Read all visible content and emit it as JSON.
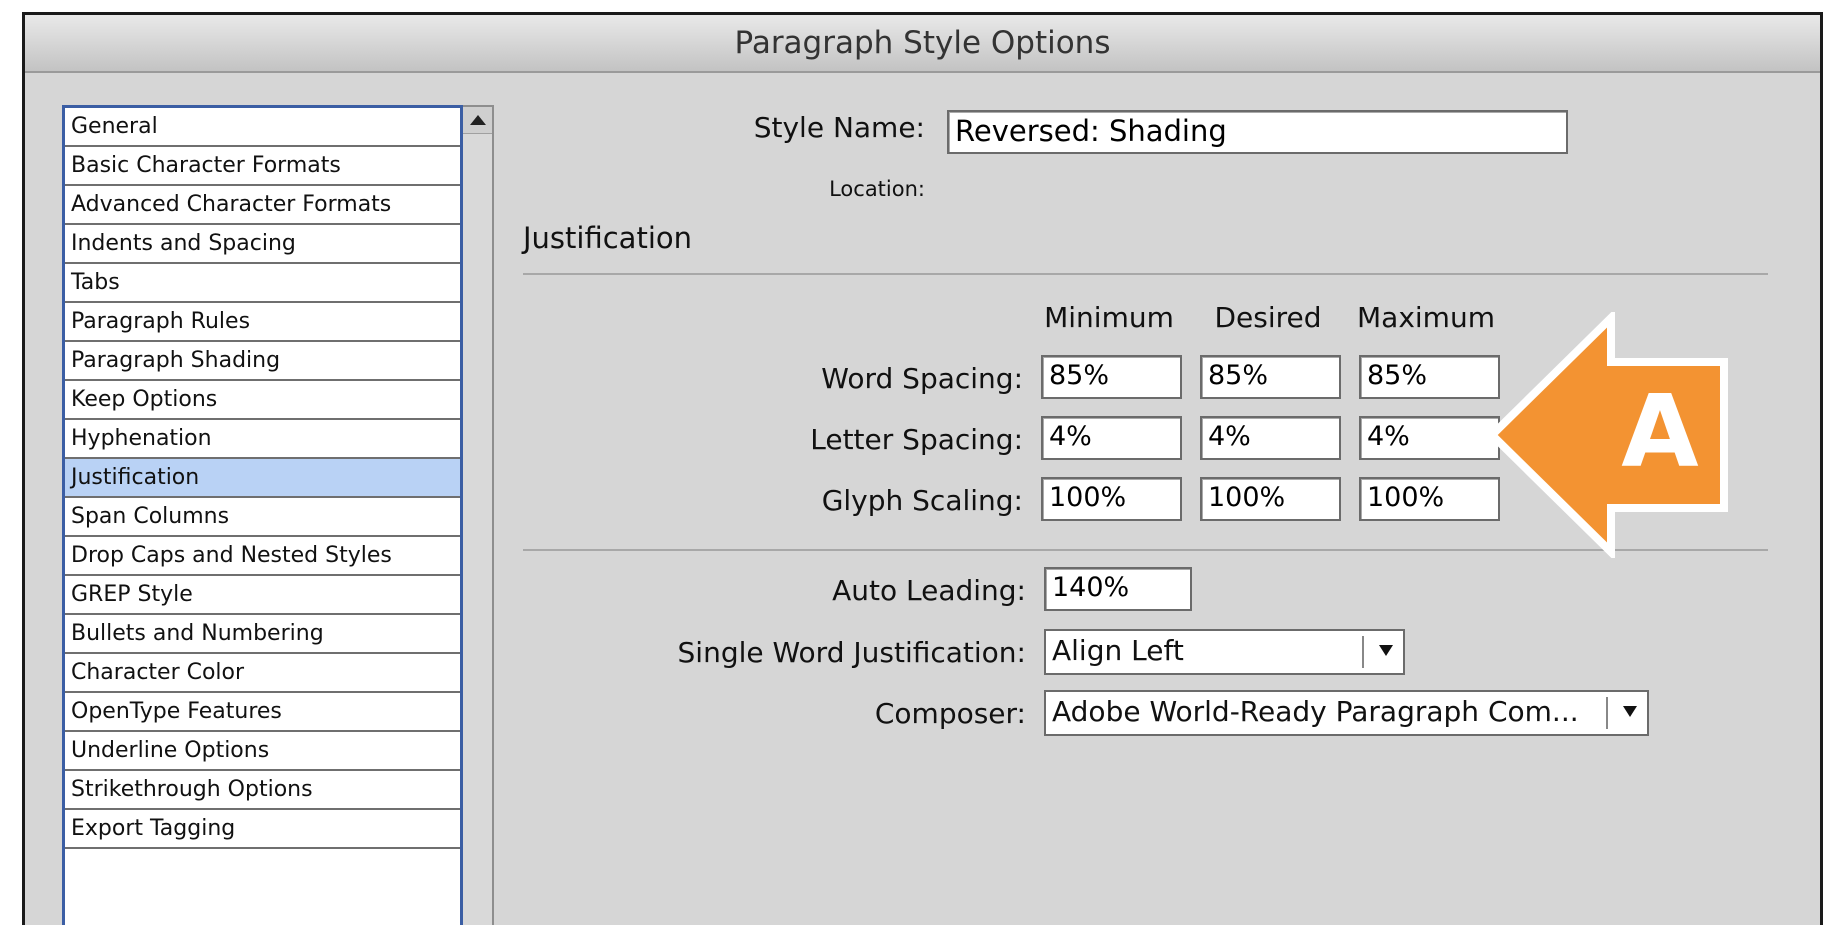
{
  "window": {
    "title": "Paragraph Style Options"
  },
  "sidebar": {
    "items": [
      {
        "label": "General"
      },
      {
        "label": "Basic Character Formats"
      },
      {
        "label": "Advanced Character Formats"
      },
      {
        "label": "Indents and Spacing"
      },
      {
        "label": "Tabs"
      },
      {
        "label": "Paragraph Rules"
      },
      {
        "label": "Paragraph Shading"
      },
      {
        "label": "Keep Options"
      },
      {
        "label": "Hyphenation"
      },
      {
        "label": "Justification"
      },
      {
        "label": "Span Columns"
      },
      {
        "label": "Drop Caps and Nested Styles"
      },
      {
        "label": "GREP Style"
      },
      {
        "label": "Bullets and Numbering"
      },
      {
        "label": "Character Color"
      },
      {
        "label": "OpenType Features"
      },
      {
        "label": "Underline Options"
      },
      {
        "label": "Strikethrough Options"
      },
      {
        "label": "Export Tagging"
      }
    ],
    "selected": "Justification"
  },
  "header": {
    "style_name_label": "Style Name:",
    "style_name_value": "Reversed: Shading",
    "location_label": "Location:"
  },
  "section": {
    "title": "Justification"
  },
  "spacing": {
    "columns": {
      "minimum": "Minimum",
      "desired": "Desired",
      "maximum": "Maximum"
    },
    "word": {
      "label": "Word Spacing:",
      "minimum": "85%",
      "desired": "85%",
      "maximum": "85%"
    },
    "letter": {
      "label": "Letter Spacing:",
      "minimum": "4%",
      "desired": "4%",
      "maximum": "4%"
    },
    "glyph": {
      "label": "Glyph Scaling:",
      "minimum": "100%",
      "desired": "100%",
      "maximum": "100%"
    }
  },
  "options": {
    "auto_leading_label": "Auto Leading:",
    "auto_leading_value": "140%",
    "single_word_label": "Single Word Justification:",
    "single_word_value": "Align Left",
    "composer_label": "Composer:",
    "composer_value": "Adobe World-Ready Paragraph Com..."
  },
  "callout": {
    "letter": "A",
    "color": "#f39332"
  },
  "colors": {
    "selection": "#b9d2f5",
    "list_border": "#3b5ea4"
  }
}
